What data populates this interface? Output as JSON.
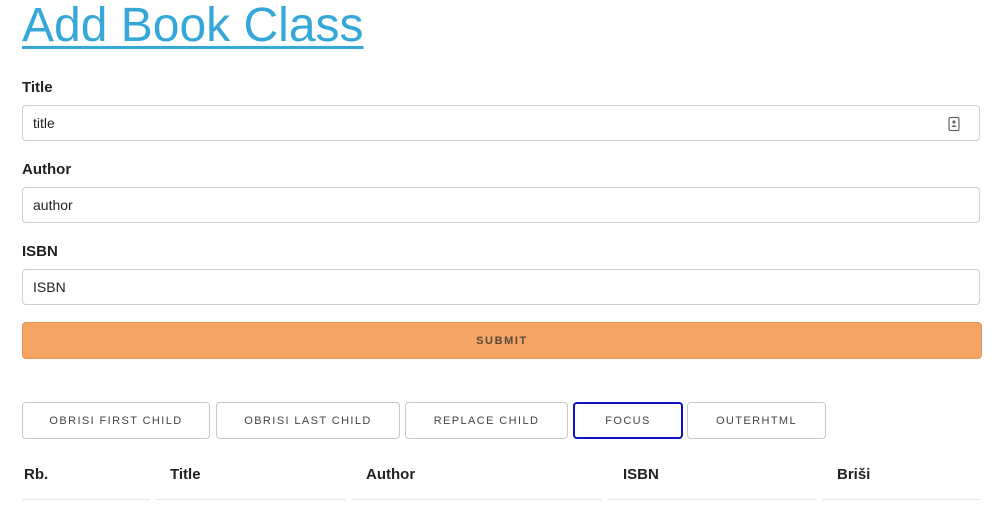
{
  "page": {
    "title": "Add Book Class"
  },
  "form": {
    "title_label": "Title",
    "title_value": "title",
    "author_label": "Author",
    "author_value": "author",
    "isbn_label": "ISBN",
    "isbn_value": "ISBN",
    "submit_label": "SUBMIT"
  },
  "actions": {
    "remove_first_label": "OBRISI FIRST CHILD",
    "remove_last_label": "OBRISI LAST CHILD",
    "replace_label": "REPLACE CHILD",
    "focus_label": "FOCUS",
    "outerhtml_label": "OUTERHTML"
  },
  "table": {
    "columns": [
      "Rb.",
      "Title",
      "Author",
      "ISBN",
      "Briši"
    ]
  },
  "colors": {
    "title_link": "#35a8d8",
    "submit_bg": "#f4a565",
    "focus_ring": "#1010c8"
  },
  "icons": {
    "autofill": "contact-card-icon"
  }
}
